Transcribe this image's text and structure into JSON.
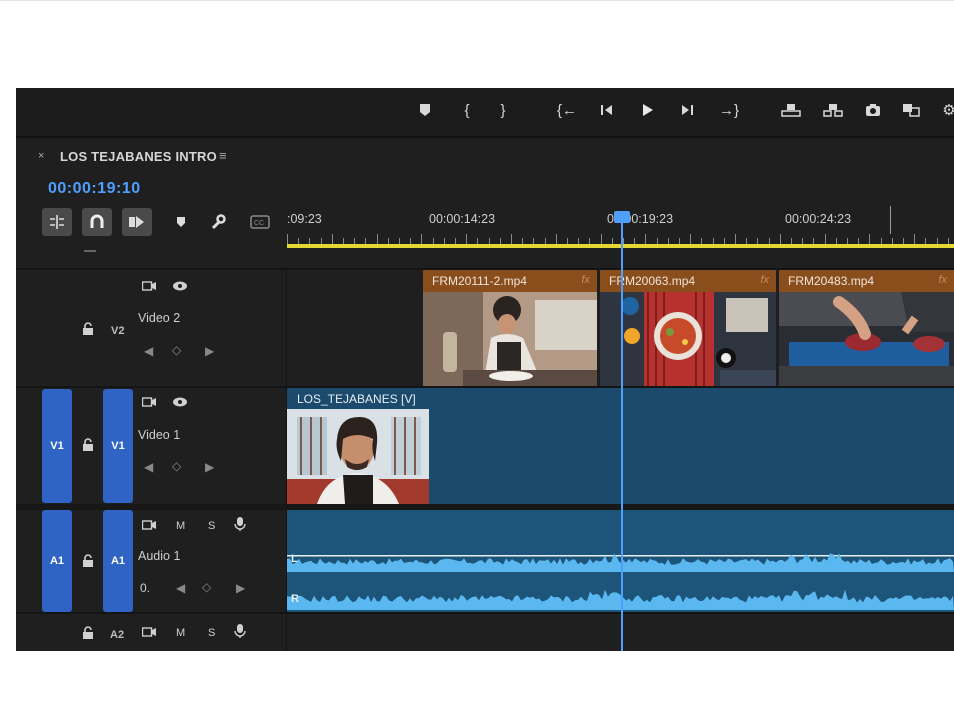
{
  "toolbar": {
    "icons": [
      "marker-icon",
      "mark-in-icon",
      "mark-out-icon",
      "go-to-in-icon",
      "step-back-icon",
      "play-icon",
      "step-forward-icon",
      "go-to-out-icon",
      "lift-icon",
      "extract-icon",
      "export-frame-icon",
      "comparison-view-icon"
    ]
  },
  "sequence": {
    "close": "×",
    "title": "LOS TEJABANES INTRO",
    "menu": "≡",
    "timecode": "00:00:19:10"
  },
  "tools": [
    "insert-nest-icon",
    "snap-icon",
    "linked-selection-icon",
    "add-marker-icon",
    "settings-wrench-icon",
    "captions-icon"
  ],
  "ruler": {
    "labels": [
      ":09:23",
      "00:00:14:23",
      "00:00:19:23",
      "00:00:24:23"
    ]
  },
  "tracks": {
    "v2": {
      "target": "V2",
      "name": "Video 2"
    },
    "v1": {
      "source": "V1",
      "target": "V1",
      "name": "Video 1"
    },
    "a1": {
      "source": "A1",
      "target": "A1",
      "name": "Audio 1",
      "m": "M",
      "s": "S",
      "volume": "0."
    },
    "a2": {
      "target": "A2",
      "m": "M",
      "s": "S"
    }
  },
  "clips": {
    "v2": [
      {
        "name": "FRM20111-2.mp4",
        "fx": "fx"
      },
      {
        "name": "FRM20063.mp4",
        "fx": "fx"
      },
      {
        "name": "FRM20483.mp4",
        "fx": "fx"
      }
    ],
    "v1": {
      "name": "LOS_TEJABANES [V]"
    },
    "a1": {
      "left": "L",
      "right": "R"
    }
  },
  "colors": {
    "accent": "#4f9fff",
    "clip_video_label": "#8a4e1c",
    "clip_sequence": "#1b4a6c",
    "clip_audio": "#1c5579",
    "waveform": "#5bb7ef",
    "track_target": "#2f63c4",
    "work_area": "#e6d833"
  }
}
